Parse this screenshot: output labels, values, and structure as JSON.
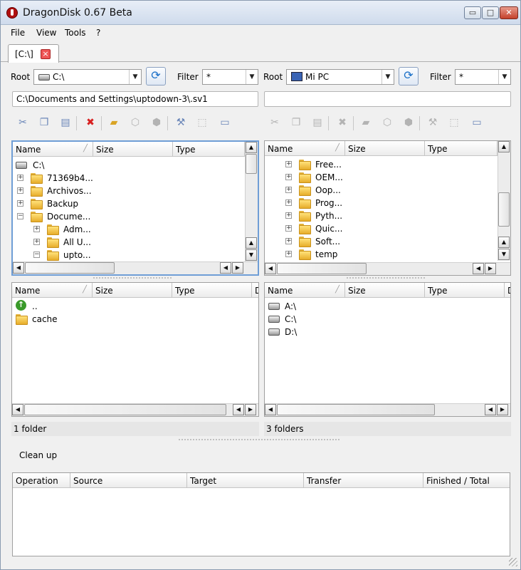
{
  "window": {
    "title": "DragonDisk 0.67 Beta",
    "controls": {
      "minimize": "▭",
      "maximize": "□",
      "close": "✕"
    }
  },
  "menu": [
    "File",
    "View",
    "Tools",
    "?"
  ],
  "tab": {
    "label": "[C:\\]",
    "close": "×"
  },
  "left": {
    "root_label": "Root",
    "root_value": "C:\\",
    "filter_label": "Filter",
    "filter_value": "*",
    "path": "C:\\Documents and Settings\\uptodown-3\\.sv1",
    "tree_headers": [
      "Name",
      "Size",
      "Type"
    ],
    "tree": [
      {
        "label": "C:\\",
        "level": 0,
        "kind": "drive"
      },
      {
        "label": "71369b4...",
        "level": 1,
        "kind": "folder",
        "exp": "+"
      },
      {
        "label": "Archivos...",
        "level": 1,
        "kind": "folder",
        "exp": "+"
      },
      {
        "label": "Backup",
        "level": 1,
        "kind": "folder",
        "exp": "+"
      },
      {
        "label": "Docume...",
        "level": 1,
        "kind": "folder",
        "exp": "−"
      },
      {
        "label": "Adm...",
        "level": 2,
        "kind": "folder",
        "exp": "+"
      },
      {
        "label": "All U...",
        "level": 2,
        "kind": "folder",
        "exp": "+"
      },
      {
        "label": "upto...",
        "level": 2,
        "kind": "folder",
        "exp": "−"
      }
    ],
    "list_headers": [
      "Name",
      "Size",
      "Type",
      "D"
    ],
    "list": [
      {
        "label": "..",
        "kind": "up"
      },
      {
        "label": "cache",
        "kind": "folder"
      }
    ],
    "status": "1 folder"
  },
  "right": {
    "root_label": "Root",
    "root_value": "Mi PC",
    "filter_label": "Filter",
    "filter_value": "*",
    "path": "",
    "tree_headers": [
      "Name",
      "Size",
      "Type"
    ],
    "tree": [
      {
        "label": "Free...",
        "level": 2,
        "kind": "folder",
        "exp": "+"
      },
      {
        "label": "OEM...",
        "level": 2,
        "kind": "folder",
        "exp": "+"
      },
      {
        "label": "Oop...",
        "level": 2,
        "kind": "folder",
        "exp": "+"
      },
      {
        "label": "Prog...",
        "level": 2,
        "kind": "folder",
        "exp": "+"
      },
      {
        "label": "Pyth...",
        "level": 2,
        "kind": "folder",
        "exp": "+"
      },
      {
        "label": "Quic...",
        "level": 2,
        "kind": "folder",
        "exp": "+"
      },
      {
        "label": "Soft...",
        "level": 2,
        "kind": "folder",
        "exp": "+"
      },
      {
        "label": "temp",
        "level": 2,
        "kind": "folder",
        "exp": "+"
      }
    ],
    "list_headers": [
      "Name",
      "Size",
      "Type",
      "D"
    ],
    "list": [
      {
        "label": "A:\\",
        "kind": "drive"
      },
      {
        "label": "C:\\",
        "kind": "drive"
      },
      {
        "label": "D:\\",
        "kind": "drive"
      }
    ],
    "status": "3 folders"
  },
  "toolbar_icons": [
    "cut-icon",
    "copy-icon",
    "paste-icon",
    "delete-icon",
    "new-folder-icon",
    "properties-icon",
    "sync-icon",
    "tools-icon",
    "info-icon",
    "view-options-icon"
  ],
  "cleanup_label": "Clean up",
  "queue_headers": [
    "Operation",
    "Source",
    "Target",
    "Transfer",
    "Finished / Total"
  ],
  "colors": {
    "focus_border": "#6f9ed6",
    "delete": "#d82020",
    "folder": "#e7ad2a"
  }
}
